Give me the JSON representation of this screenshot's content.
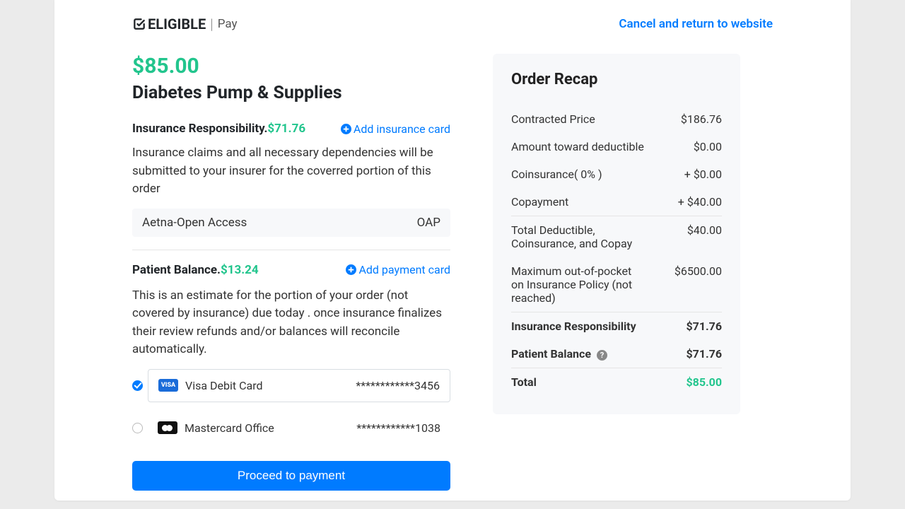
{
  "header": {
    "brand_main": "ELIGIBLE",
    "brand_sub": "Pay",
    "cancel_link": "Cancel and return to website"
  },
  "order": {
    "price": "$85.00",
    "title": "Diabetes Pump & Supplies",
    "insurance_label": "Insurance Responsibility.",
    "insurance_amount": "$71.76",
    "add_insurance": "Add insurance card",
    "insurance_desc": "Insurance claims and all necessary dependencies will be submitted to your insurer for the coverred portion of this order",
    "insurance_plan_name": "Aetna-Open Access",
    "insurance_plan_code": "OAP",
    "patient_label": "Patient Balance.",
    "patient_amount": "$13.24",
    "add_payment": "Add payment card",
    "patient_desc": "This is an estimate for the portion of your order (not covered by insurance) due today . once insurance finalizes their review refunds and/or balances will reconcile automatically.",
    "proceed_button": "Proceed to payment"
  },
  "payment_cards": [
    {
      "selected": true,
      "brand": "visa",
      "label": "Visa Debit Card",
      "masked": "************3456"
    },
    {
      "selected": false,
      "brand": "mc",
      "label": "Mastercard Office",
      "masked": "************1038"
    }
  ],
  "recap": {
    "title": "Order Recap",
    "rows": [
      {
        "label": "Contracted Price",
        "value": "$186.76"
      },
      {
        "label": "Amount toward deductible",
        "value": "$0.00"
      },
      {
        "label": "Coinsurance( 0% )",
        "value": "+ $0.00"
      },
      {
        "label": "Copayment",
        "value": "+ $40.00"
      }
    ],
    "subrows": [
      {
        "label": "Total Deductible, Coinsurance, and Copay",
        "value": "$40.00"
      },
      {
        "label": "Maximum out-of-pocket on Insurance Policy (not reached)",
        "value": "$6500.00"
      }
    ],
    "bold_rows": [
      {
        "label": "Insurance Responsibility",
        "value": "$71.76"
      },
      {
        "label": "Patient Balance",
        "value": "$71.76",
        "help": true
      }
    ],
    "total_label": "Total",
    "total_value": "$85.00"
  }
}
